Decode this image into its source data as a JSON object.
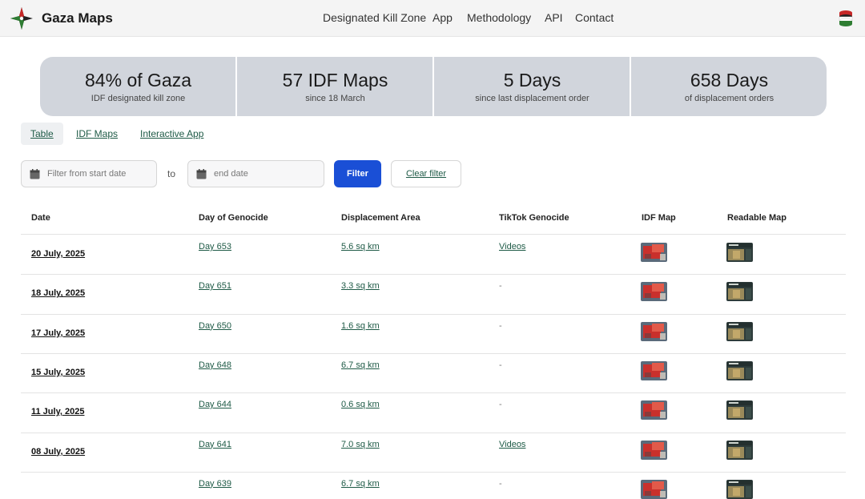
{
  "header": {
    "brand": "Gaza Maps",
    "nav": [
      "Designated Kill Zone",
      "App",
      "Methodology",
      "API",
      "Contact"
    ]
  },
  "stats": [
    {
      "value": "84% of Gaza",
      "sub": "IDF designated kill zone"
    },
    {
      "value": "57 IDF Maps",
      "sub": "since 18 March"
    },
    {
      "value": "5 Days",
      "sub": "since last displacement order"
    },
    {
      "value": "658 Days",
      "sub": "of displacement orders"
    }
  ],
  "tabs": [
    "Table",
    "IDF Maps",
    "Interactive App"
  ],
  "filter": {
    "start_placeholder": "Filter from start date",
    "to_label": "to",
    "end_placeholder": "end date",
    "filter_button": "Filter",
    "clear_button": "Clear filter"
  },
  "table": {
    "columns": [
      "Date",
      "Day of Genocide",
      "Displacement Area",
      "TikTok Genocide",
      "IDF Map",
      "Readable Map"
    ],
    "rows": [
      {
        "date": "20 July, 2025",
        "day": "Day 653",
        "area": "5.6 sq km",
        "tiktok": "Videos"
      },
      {
        "date": "18 July, 2025",
        "day": "Day 651",
        "area": "3.3 sq km",
        "tiktok": "-"
      },
      {
        "date": "17 July, 2025",
        "day": "Day 650",
        "area": "1.6 sq km",
        "tiktok": "-"
      },
      {
        "date": "15 July, 2025",
        "day": "Day 648",
        "area": "6.7 sq km",
        "tiktok": "-"
      },
      {
        "date": "11 July, 2025",
        "day": "Day 644",
        "area": "0.6 sq km",
        "tiktok": "-"
      },
      {
        "date": "08 July, 2025",
        "day": "Day 641",
        "area": "7.0 sq km",
        "tiktok": "Videos"
      },
      {
        "date": "",
        "day": "Day 639",
        "area": "6.7 sq km",
        "tiktok": "-"
      }
    ]
  },
  "colors": {
    "accent_blue": "#1a4fd6",
    "link_green": "#1e5a46",
    "stats_bg": "#d1d5dc"
  },
  "icons": [
    "star-logo-icon",
    "database-icon",
    "calendar-icon"
  ]
}
